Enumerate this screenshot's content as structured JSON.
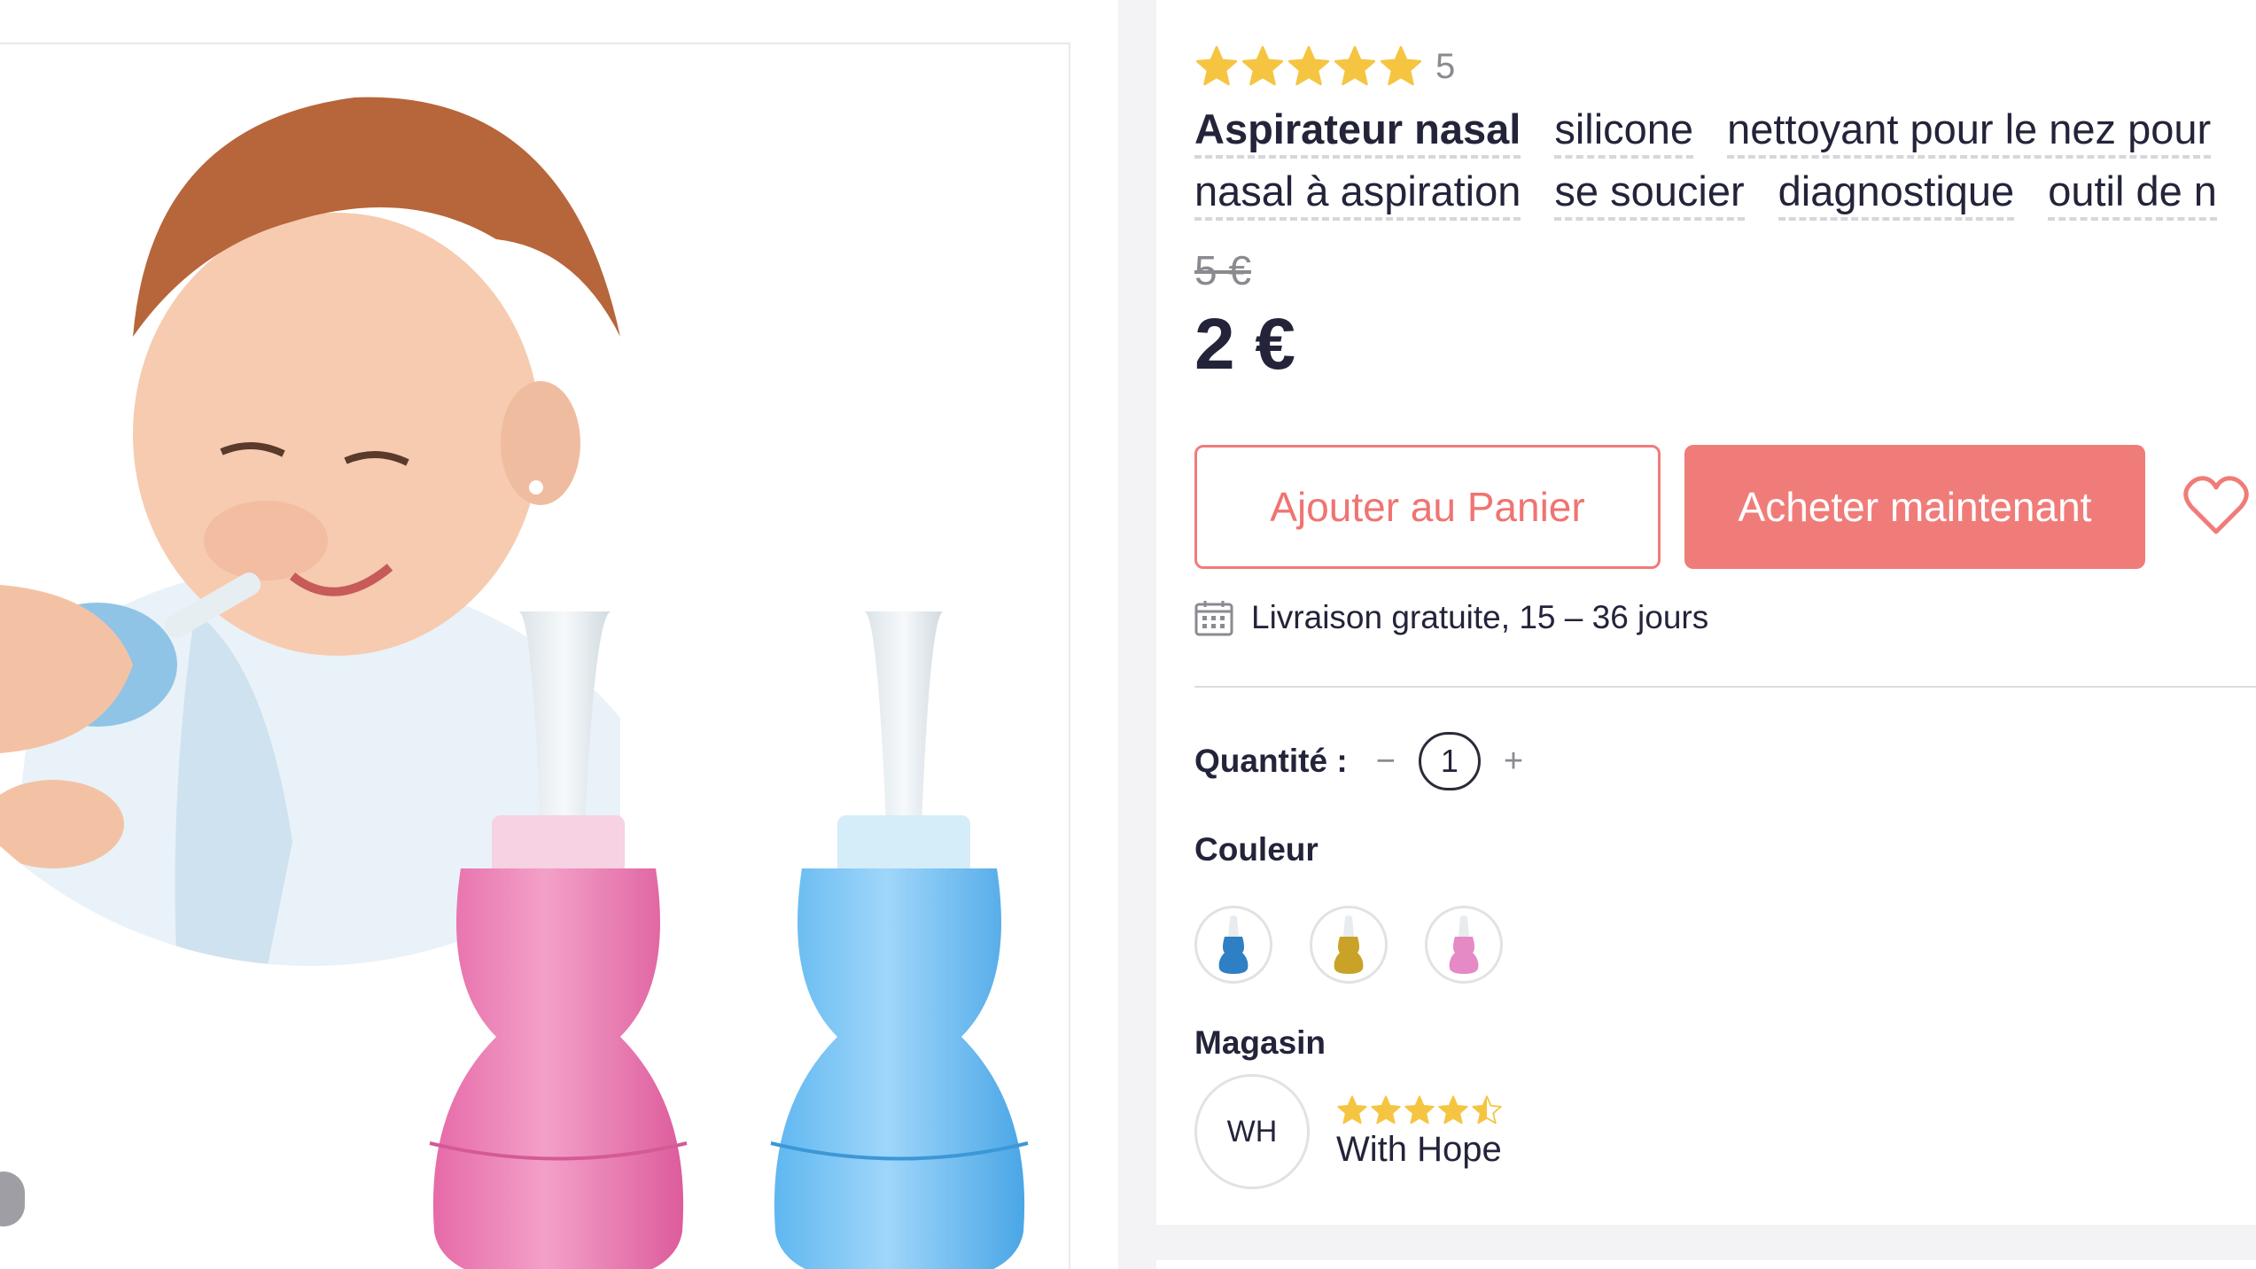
{
  "product": {
    "rating_count": "5",
    "rating_value": 5,
    "title_line1": [
      "Aspirateur nasal",
      "silicone",
      "nettoyant pour le nez pour"
    ],
    "title_line2": [
      "nasal à aspiration",
      "se soucier",
      "diagnostique",
      "outil de n"
    ],
    "old_price": "5 €",
    "price": "2 €",
    "image_icon": "baby-nasal-aspirator-photo"
  },
  "actions": {
    "add_to_cart": "Ajouter au Panier",
    "buy_now": "Acheter maintenant",
    "wishlist_icon": "heart-icon"
  },
  "delivery": {
    "icon": "calendar-icon",
    "text": "Livraison gratuite, 15 – 36 jours"
  },
  "quantity": {
    "label": "Quantité :",
    "minus": "−",
    "value": "1",
    "plus": "+"
  },
  "color": {
    "label": "Couleur",
    "options": [
      {
        "name": "blue",
        "color": "#2f7fc4"
      },
      {
        "name": "yellow",
        "color": "#c9a227"
      },
      {
        "name": "pink",
        "color": "#e58ac4"
      }
    ]
  },
  "store": {
    "label": "Magasin",
    "initials": "WH",
    "name": "With Hope",
    "rating": 4.5
  },
  "colors": {
    "accent": "#f07c79",
    "star": "#f5c542",
    "text": "#23243a",
    "muted": "#8a8a90"
  }
}
